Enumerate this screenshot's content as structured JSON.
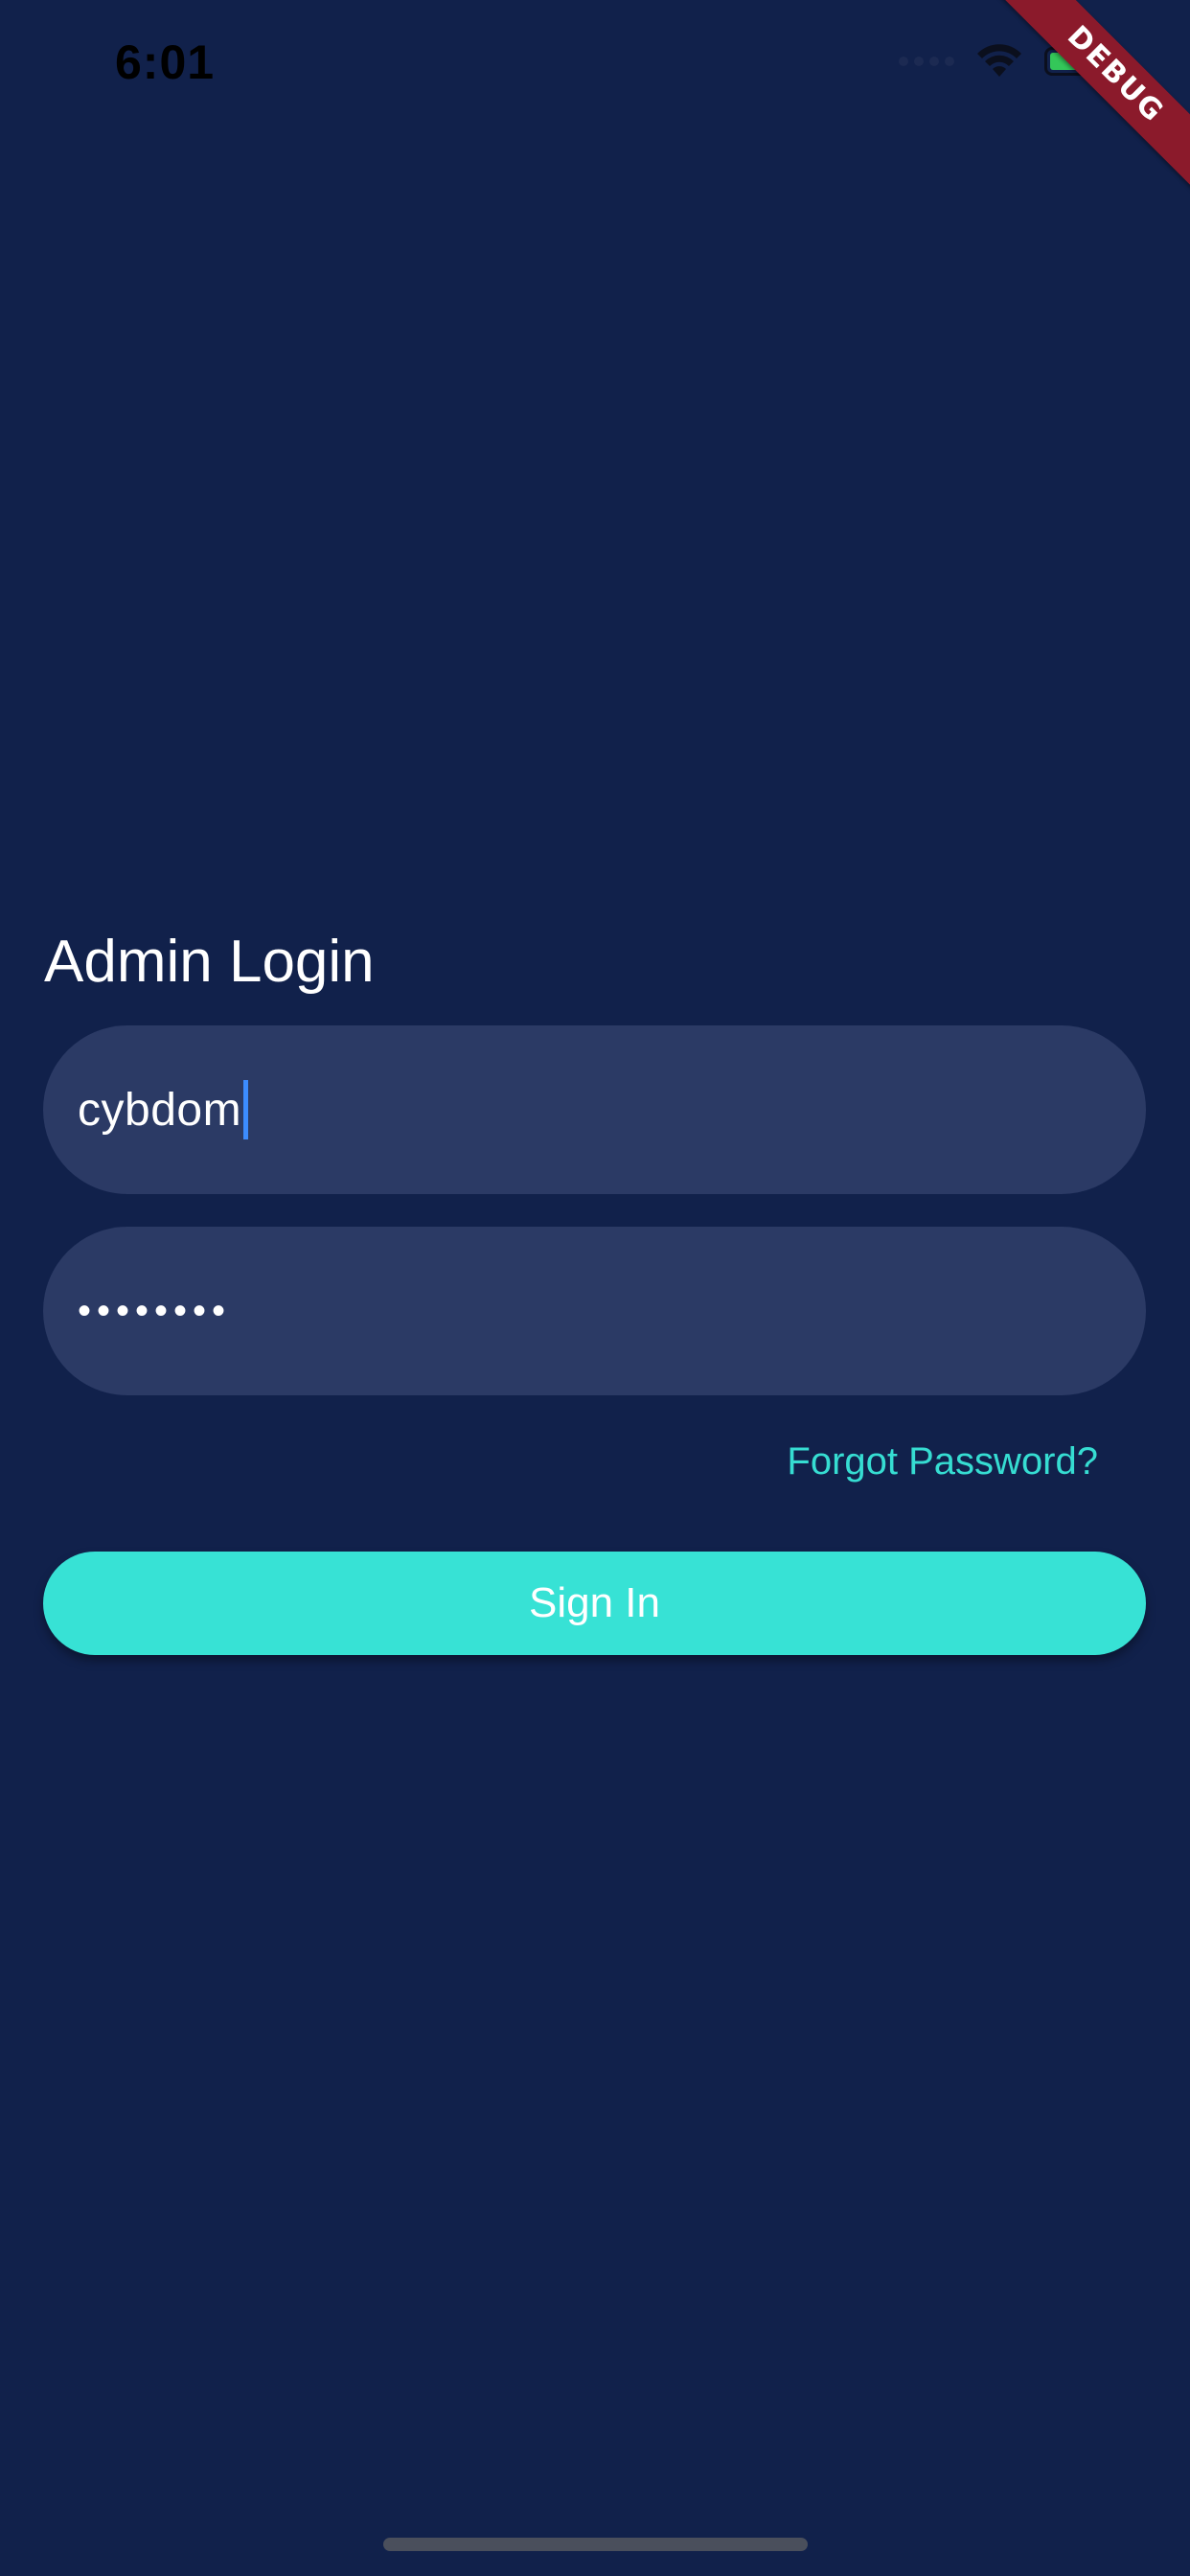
{
  "status_bar": {
    "time": "6:01",
    "icons": [
      "signal-icon",
      "wifi-icon",
      "battery-charging-icon"
    ]
  },
  "debug_banner": {
    "label": "DEBUG"
  },
  "login": {
    "title": "Admin Login",
    "username_value": "cybdom",
    "password_masked": "••••••••",
    "forgot_password_label": "Forgot Password?",
    "sign_in_label": "Sign In"
  },
  "colors": {
    "background": "#11214b",
    "field_background": "#2b3a65",
    "accent": "#37e2d5",
    "debug_ribbon": "#8b1a2b",
    "cursor": "#3c8cff"
  }
}
